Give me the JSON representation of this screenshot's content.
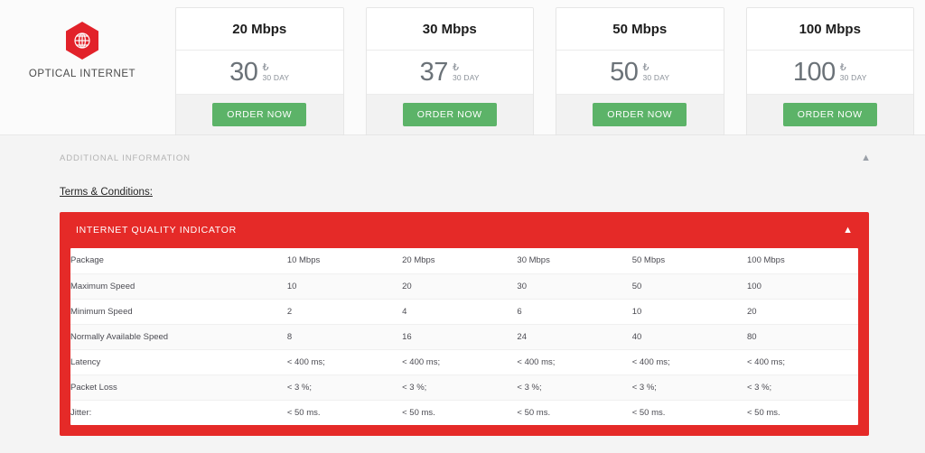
{
  "brand": {
    "label": "OPTICAL INTERNET",
    "logo_icon": "globe-hexagon-icon",
    "logo_color": "#e2222a"
  },
  "plans": [
    {
      "title": "20 Mbps",
      "price": "30",
      "currency": "₺",
      "period": "30 DAY",
      "cta": "ORDER NOW"
    },
    {
      "title": "30 Mbps",
      "price": "37",
      "currency": "₺",
      "period": "30 DAY",
      "cta": "ORDER NOW"
    },
    {
      "title": "50 Mbps",
      "price": "50",
      "currency": "₺",
      "period": "30 DAY",
      "cta": "ORDER NOW"
    },
    {
      "title": "100 Mbps",
      "price": "100",
      "currency": "₺",
      "period": "30 DAY",
      "cta": "ORDER NOW"
    }
  ],
  "additional_information": {
    "title": "ADDITIONAL INFORMATION",
    "collapse_icon": "chevron-up-icon",
    "terms_link": "Terms & Conditions:"
  },
  "quality_panel": {
    "title": "INTERNET QUALITY INDICATOR",
    "collapse_icon": "chevron-up-icon",
    "accent_color": "#e52a28",
    "table": {
      "columns": [
        "Package",
        "10 Mbps",
        "20 Mbps",
        "30 Mbps",
        "50 Mbps",
        "100 Mbps"
      ],
      "rows": [
        {
          "label": "Package",
          "values": [
            "10 Mbps",
            "20 Mbps",
            "30 Mbps",
            "50 Mbps",
            "100 Mbps"
          ]
        },
        {
          "label": "Maximum Speed",
          "values": [
            "10",
            "20",
            "30",
            "50",
            "100"
          ]
        },
        {
          "label": "Minimum Speed",
          "values": [
            "2",
            "4",
            "6",
            "10",
            "20"
          ]
        },
        {
          "label": "Normally Available Speed",
          "values": [
            "8",
            "16",
            "24",
            "40",
            "80"
          ]
        },
        {
          "label": "Latency",
          "values": [
            "< 400 ms;",
            "< 400 ms;",
            "< 400 ms;",
            "< 400 ms;",
            "< 400 ms;"
          ]
        },
        {
          "label": "Packet Loss",
          "values": [
            "< 3 %;",
            "< 3 %;",
            "< 3 %;",
            "< 3 %;",
            "< 3 %;"
          ]
        },
        {
          "label": "Jitter:",
          "values": [
            "< 50 ms.",
            "< 50 ms.",
            "< 50 ms.",
            "< 50 ms.",
            "< 50 ms."
          ]
        }
      ]
    }
  }
}
